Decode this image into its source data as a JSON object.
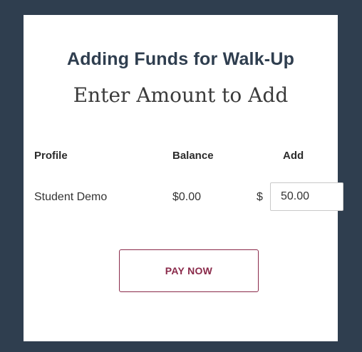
{
  "header": {
    "title": "Adding Funds for Walk-Up",
    "subtitle": "Enter Amount to Add"
  },
  "table": {
    "columns": [
      "Profile",
      "Balance",
      "Add"
    ],
    "row": {
      "profile": "Student Demo",
      "balance": "$0.00",
      "currency_symbol": "$",
      "add_value": "50.00"
    }
  },
  "actions": {
    "pay_label": "PAY NOW"
  },
  "colors": {
    "frame": "#2f3e4f",
    "accent": "#8a2a4a"
  }
}
